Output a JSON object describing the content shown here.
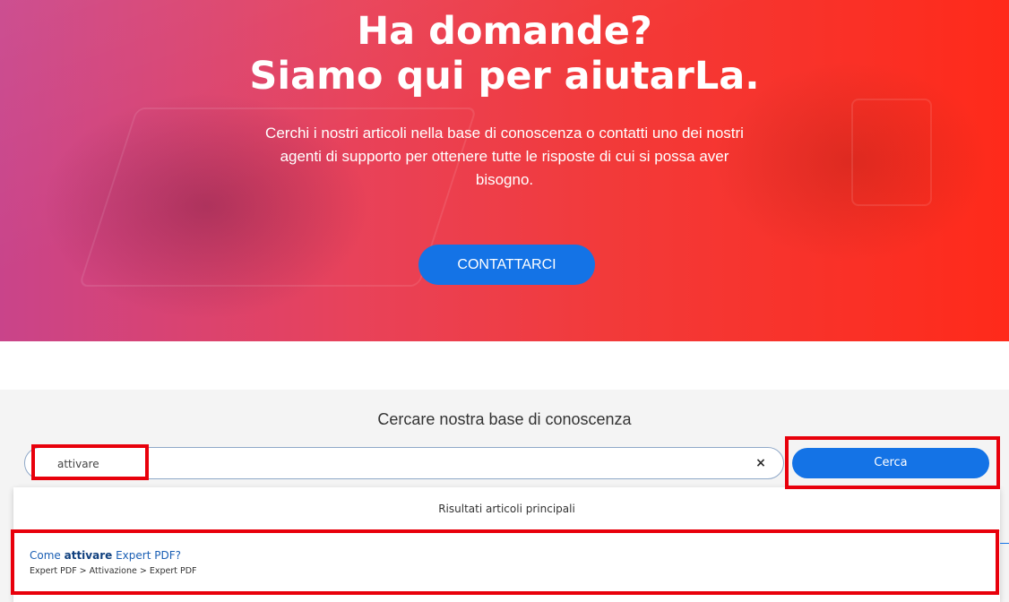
{
  "hero": {
    "title_line1": "Ha domande?",
    "title_line2": "Siamo qui per aiutarLa.",
    "subtitle": "Cerchi i nostri articoli nella base di conoscenza o contatti uno dei nostri agenti di supporto per ottenere tutte le risposte di cui si possa aver bisogno.",
    "contact_button": "CONTATTARCI"
  },
  "search": {
    "heading": "Cercare nostra base di conoscenza",
    "input_value": "attivare",
    "clear_icon": "close-icon",
    "clear_glyph": "×",
    "button_label": "Cerca"
  },
  "dropdown": {
    "header": "Risultati articoli principali",
    "results": [
      {
        "title_prefix": "Come ",
        "title_match": "attivare",
        "title_suffix": " Expert PDF?",
        "path": "Expert PDF > Attivazione > Expert PDF"
      }
    ]
  },
  "colors": {
    "accent_blue": "#1473e6",
    "highlight_red": "#e8000b",
    "hero_gradient_start": "#c9448a",
    "hero_gradient_end": "#ff2a1a"
  }
}
